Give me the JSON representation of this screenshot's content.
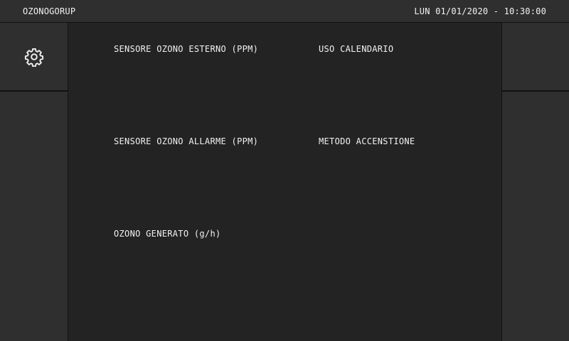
{
  "header": {
    "title": "OZONOGORUP",
    "datetime": "LUN 01/01/2020 - 10:30:00"
  },
  "sidebar_left": {
    "settings_icon": "gear-icon"
  },
  "main": {
    "labels": {
      "sensor_external": "SENSORE OZONO ESTERNO (PPM)",
      "calendar_use": "USO CALENDARIO",
      "sensor_alarm": "SENSORE OZONO ALLARME (PPM)",
      "ignition_method": "METODO ACCENSTIONE",
      "ozone_generated": "OZONO GENERATO (g/h)"
    }
  },
  "colors": {
    "background": "#232323",
    "panel": "#2f2f2f",
    "text": "#f2f2f2"
  }
}
